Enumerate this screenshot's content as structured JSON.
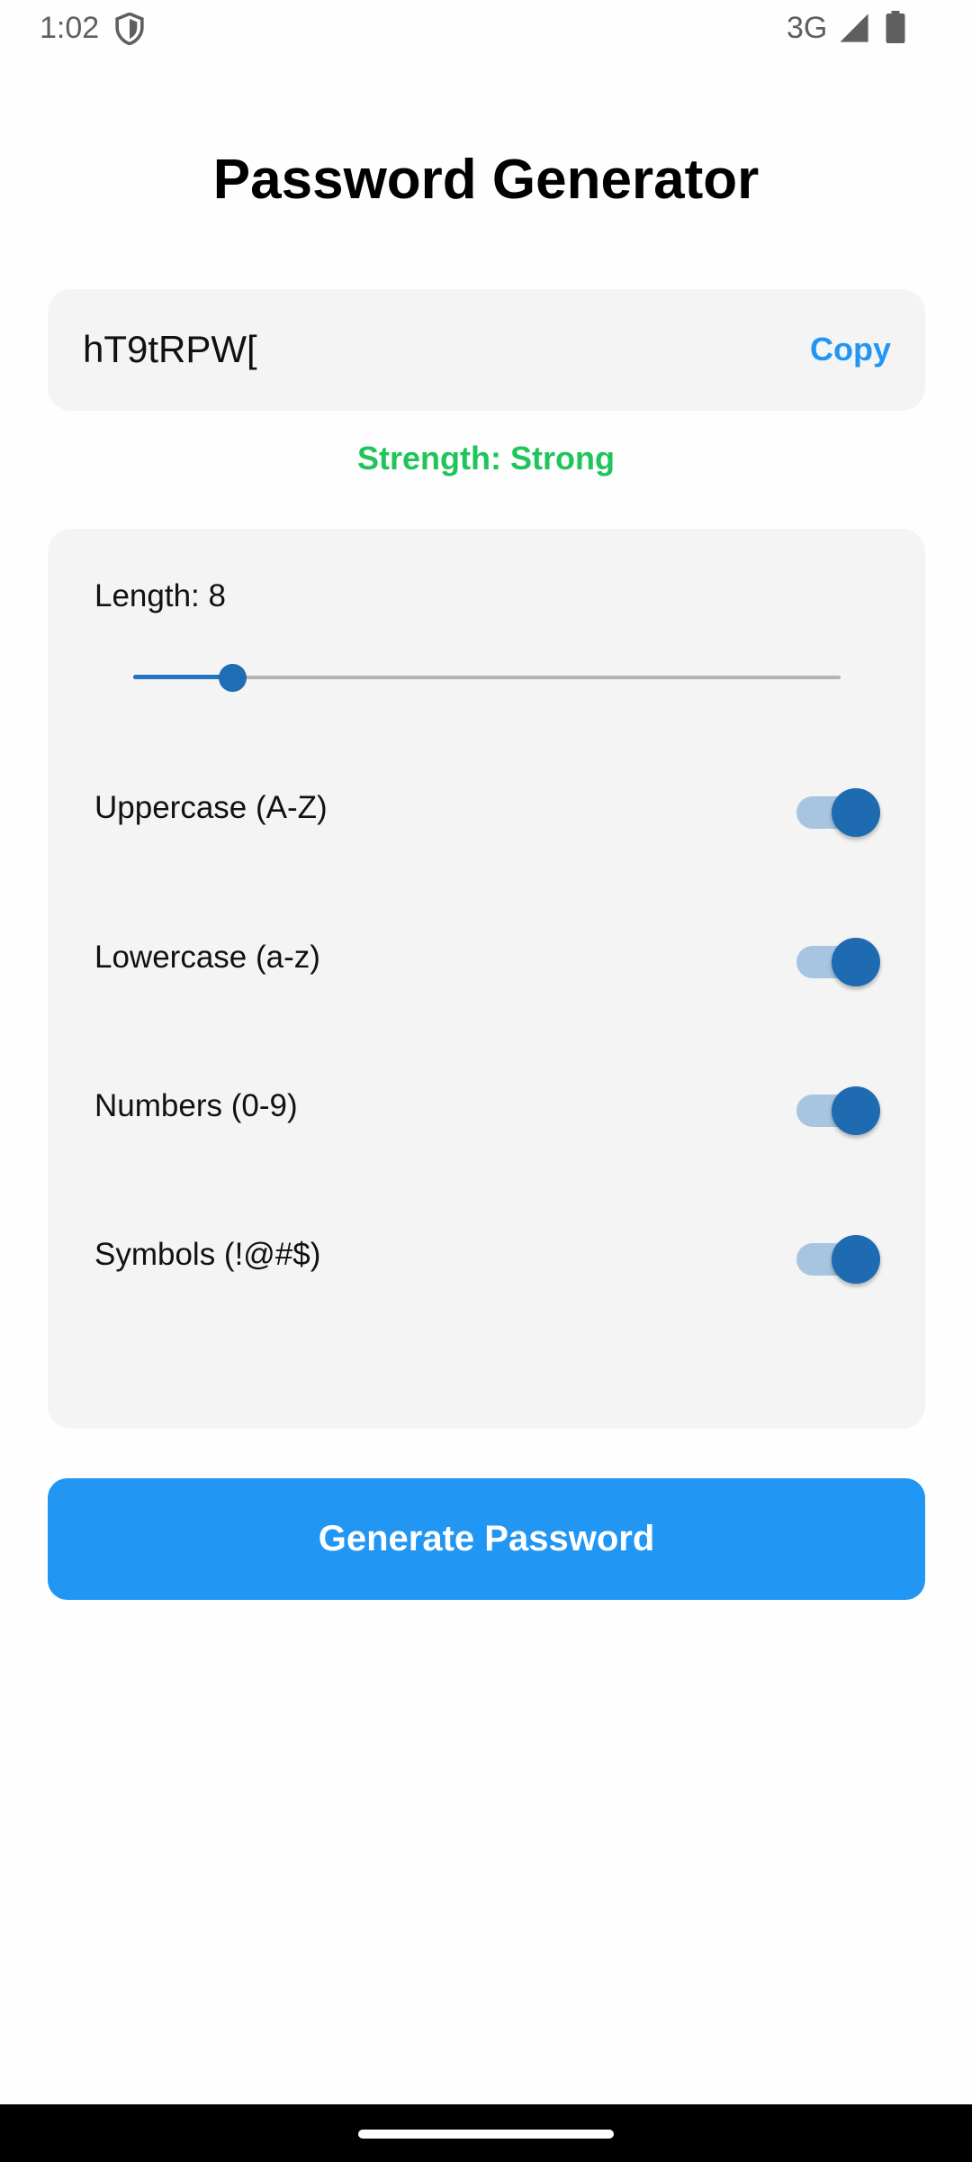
{
  "status_bar": {
    "time": "1:02",
    "network": "3G",
    "icons": [
      "shield-icon",
      "signal-icon",
      "battery-icon"
    ]
  },
  "title": "Password Generator",
  "password": {
    "value": "hT9tRPW[",
    "copy_label": "Copy"
  },
  "strength": {
    "text": "Strength: Strong",
    "color": "#1fc55a"
  },
  "length": {
    "label": "Length: 8",
    "slider_fraction": 0.14
  },
  "options": [
    {
      "label": "Uppercase (A-Z)",
      "enabled": true
    },
    {
      "label": "Lowercase (a-z)",
      "enabled": true
    },
    {
      "label": "Numbers (0-9)",
      "enabled": true
    },
    {
      "label": "Symbols (!@#$)",
      "enabled": true
    }
  ],
  "generate_label": "Generate Password",
  "colors": {
    "accent": "#2196f3",
    "toggle_on": "#1f6bb1",
    "strength_strong": "#1fc55a"
  }
}
